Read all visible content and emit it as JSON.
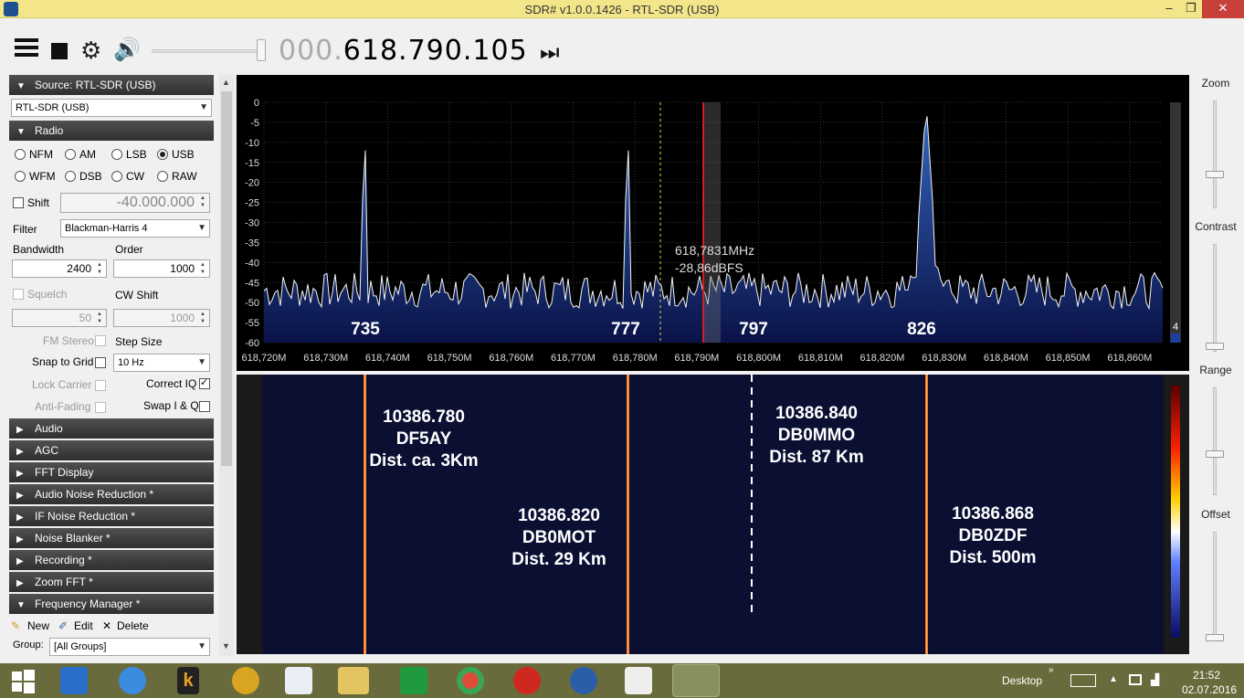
{
  "window": {
    "title": "SDR# v1.0.0.1426 - RTL-SDR (USB)",
    "minimize": "–",
    "maximize": "❐",
    "close": "✕"
  },
  "toolbar": {
    "freq_dim": "000.",
    "freq_main": "618.790.105",
    "skip_glyph": "⏭",
    "gear_glyph": "⚙",
    "speaker_glyph": "🔊"
  },
  "left": {
    "source_header": "Source: RTL-SDR (USB)",
    "source_value": "RTL-SDR (USB)",
    "radio_header": "Radio",
    "modes_row1": [
      "NFM",
      "AM",
      "LSB",
      "USB"
    ],
    "modes_row2": [
      "WFM",
      "DSB",
      "CW",
      "RAW"
    ],
    "selected_mode": "USB",
    "shift_label": "Shift",
    "shift_value": "-40.000.000",
    "filter_label": "Filter",
    "filter_value": "Blackman-Harris 4",
    "bandwidth_label": "Bandwidth",
    "bandwidth_value": "2400",
    "order_label": "Order",
    "order_value": "1000",
    "squelch_label": "Squelch",
    "squelch_value": "50",
    "cwshift_label": "CW Shift",
    "cwshift_value": "1000",
    "fmstereo_label": "FM Stereo",
    "stepsize_label": "Step Size",
    "snap_label": "Snap to Grid",
    "step_value": "10 Hz",
    "lockcarrier_label": "Lock Carrier",
    "correctiq_label": "Correct IQ",
    "antifading_label": "Anti-Fading",
    "swapiq_label": "Swap I & Q",
    "sections": [
      "Audio",
      "AGC",
      "FFT Display",
      "Audio Noise Reduction *",
      "IF Noise Reduction *",
      "Noise Blanker *",
      "Recording *",
      "Zoom FFT *"
    ],
    "freqmgr_header": "Frequency Manager *",
    "fm_new": "New",
    "fm_edit": "Edit",
    "fm_delete": "Delete",
    "group_label": "Group:",
    "group_value": "[All Groups]"
  },
  "spectrum": {
    "y_ticks": [
      "0",
      "-5",
      "-10",
      "-15",
      "-20",
      "-25",
      "-30",
      "-35",
      "-40",
      "-45",
      "-50",
      "-55",
      "-60"
    ],
    "x_ticks": [
      "618,720M",
      "618,730M",
      "618,740M",
      "618,750M",
      "618,760M",
      "618,770M",
      "618,780M",
      "618,790M",
      "618,800M",
      "618,810M",
      "618,820M",
      "618,830M",
      "618,840M",
      "618,850M",
      "618,860M"
    ],
    "cursor_freq": "618,7831MHz",
    "cursor_level": "-28,86dBFS",
    "marker_labels": [
      "735",
      "777",
      "797",
      "826"
    ],
    "scale_value": "4"
  },
  "waterfall": {
    "annotations": [
      {
        "freq": "10386.780",
        "call": "DF5AY",
        "dist": "Dist. ca. 3Km"
      },
      {
        "freq": "10386.820",
        "call": "DB0MOT",
        "dist": "Dist. 29 Km"
      },
      {
        "freq": "10386.840",
        "call": "DB0MMO",
        "dist": "Dist. 87 Km"
      },
      {
        "freq": "10386.868",
        "call": "DB0ZDF",
        "dist": "Dist. 500m"
      }
    ]
  },
  "right": {
    "zoom": "Zoom",
    "contrast": "Contrast",
    "range": "Range",
    "offset": "Offset"
  },
  "taskbar": {
    "desktop": "Desktop",
    "time": "21:52",
    "date": "02.07.2016"
  }
}
